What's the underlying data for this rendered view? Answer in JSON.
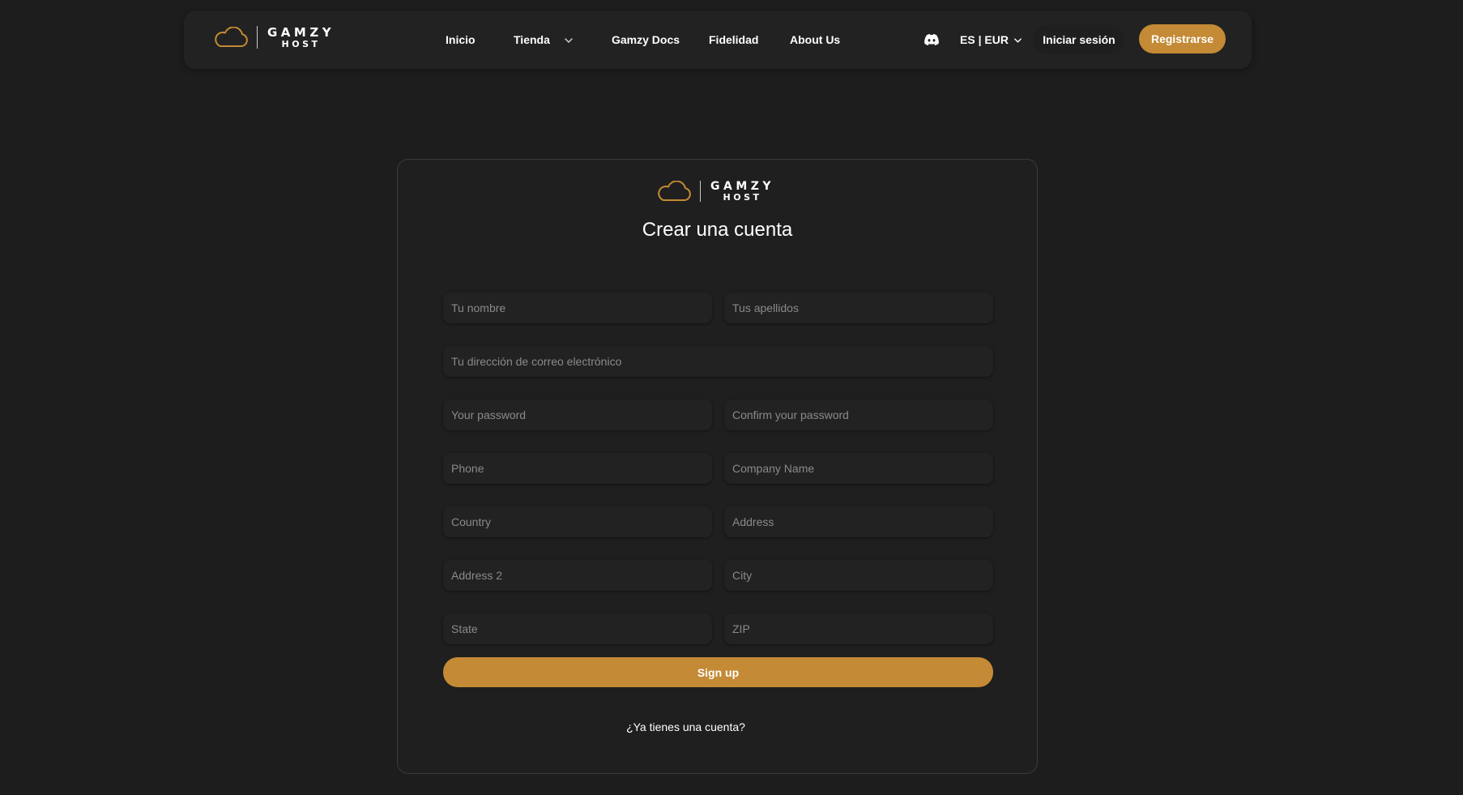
{
  "brand": {
    "name_top": "GAMZY",
    "name_bottom": "HOST",
    "accent_color": "#c48a35",
    "logo_icon": "cloud-icon"
  },
  "nav": {
    "items": [
      {
        "label": "Inicio"
      },
      {
        "label": "Tienda",
        "has_dropdown": true
      },
      {
        "label": "Gamzy Docs"
      },
      {
        "label": "Fidelidad"
      },
      {
        "label": "About Us"
      }
    ],
    "discord_icon": "discord-icon",
    "lang_currency": "ES | EUR",
    "login_label": "Iniciar sesión",
    "register_label": "Registrarse"
  },
  "form": {
    "title": "Crear una cuenta",
    "fields": {
      "first_name": "Tu nombre",
      "last_name": "Tus apellidos",
      "email": "Tu dirección de correo electrónico",
      "password": "Your password",
      "confirm_password": "Confirm your password",
      "phone": "Phone",
      "company": "Company Name",
      "country": "Country",
      "address": "Address",
      "address2": "Address 2",
      "city": "City",
      "state": "State",
      "zip": "ZIP"
    },
    "submit_label": "Sign up",
    "login_prompt": "¿Ya tienes una cuenta?"
  }
}
